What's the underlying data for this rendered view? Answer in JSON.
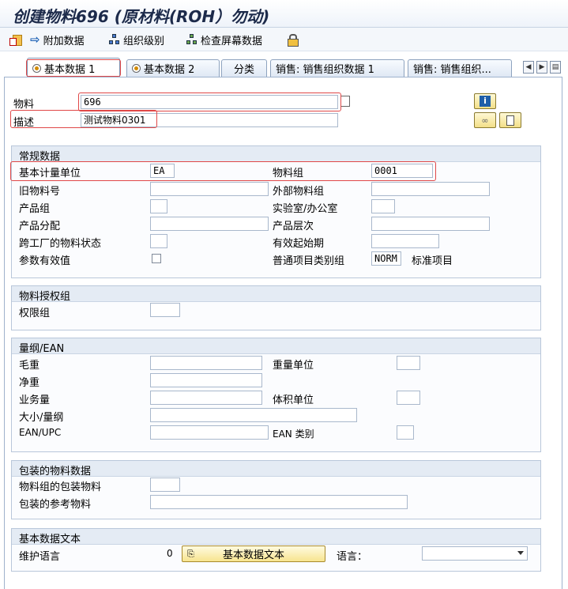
{
  "window": {
    "title": "创建物料696 (原材料(ROH）勿动)"
  },
  "toolbar": {
    "additional_data": "附加数据",
    "org_levels": "组织级别",
    "check_screen_data": "检查屏幕数据"
  },
  "tabs": [
    {
      "label": "基本数据 1"
    },
    {
      "label": "基本数据 2"
    },
    {
      "label": "分类"
    },
    {
      "label": "销售: 销售组织数据 1"
    },
    {
      "label": "销售: 销售组织..."
    }
  ],
  "header": {
    "material_label": "物料",
    "material_value": "696",
    "desc_label": "描述",
    "desc_value": "测试物料0301"
  },
  "general": {
    "title": "常规数据",
    "base_uom_label": "基本计量单位",
    "base_uom_value": "EA",
    "matl_group_label": "物料组",
    "matl_group_value": "0001",
    "old_matl_label": "旧物料号",
    "ext_matl_group_label": "外部物料组",
    "division_label": "产品组",
    "lab_office_label": "实验室/办公室",
    "product_alloc_label": "产品分配",
    "product_hier_label": "产品层次",
    "xplant_status_label": "跨工厂的物料状态",
    "valid_from_label": "有效起始期",
    "param_eff_label": "参数有效值",
    "gen_item_cat_label": "普通项目类别组",
    "gen_item_cat_value": "NORM",
    "gen_item_cat_text": "标准项目"
  },
  "auth": {
    "title": "物料授权组",
    "auth_group_label": "权限组"
  },
  "dims": {
    "title": "量纲/EAN",
    "gross_weight_label": "毛重",
    "weight_unit_label": "重量单位",
    "net_weight_label": "净重",
    "volume_label": "业务量",
    "volume_unit_label": "体积单位",
    "size_dims_label": "大小/量纲",
    "ean_upc_label": "EAN/UPC",
    "ean_cat_label": "EAN 类别"
  },
  "packaging": {
    "title": "包装的物料数据",
    "matl_grp_pack_label": "物料组的包装物料",
    "ref_matl_pack_label": "包装的参考物料"
  },
  "basic_text": {
    "title": "基本数据文本",
    "maintain_lang_label": "维护语言",
    "maintain_lang_count": "0",
    "button_label": "基本数据文本",
    "language_label": "语言："
  }
}
